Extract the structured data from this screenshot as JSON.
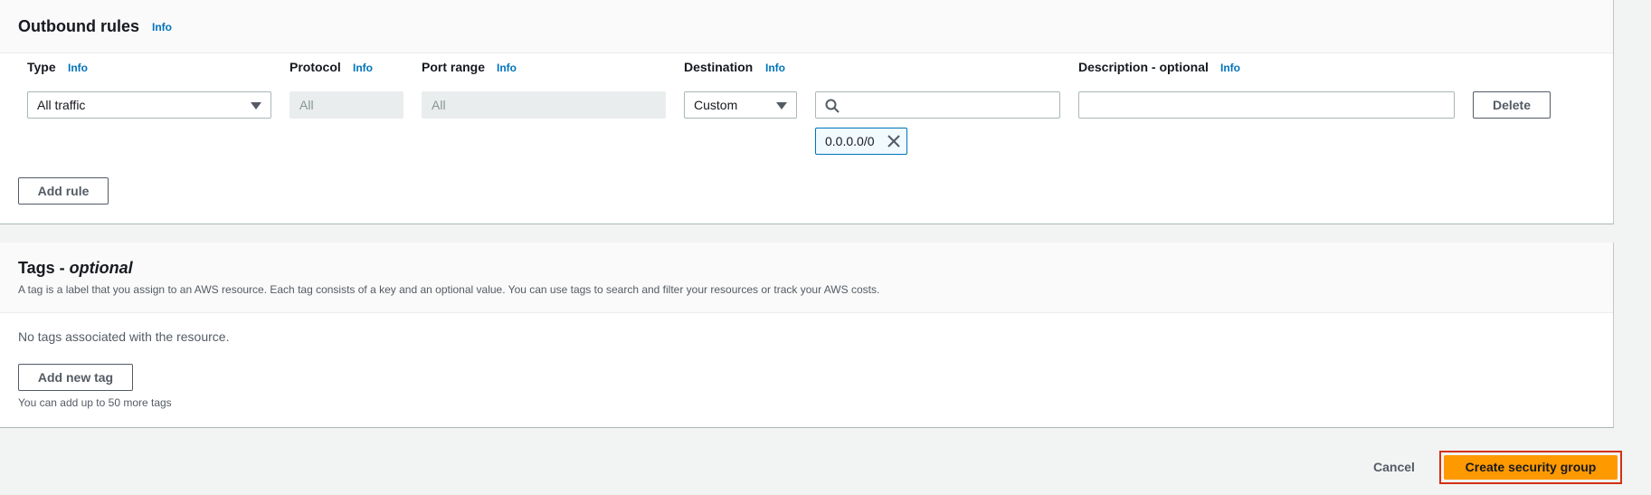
{
  "outbound": {
    "title": "Outbound rules",
    "info": "Info",
    "columns": {
      "type": "Type",
      "protocol": "Protocol",
      "port_range": "Port range",
      "destination": "Destination",
      "description": "Description - optional"
    },
    "rule": {
      "type_value": "All traffic",
      "protocol_value": "All",
      "port_range_value": "All",
      "destination_value": "Custom",
      "search_value": "",
      "description_value": "",
      "cidr_token": "0.0.0.0/0",
      "delete_label": "Delete"
    },
    "add_rule_label": "Add rule"
  },
  "tags": {
    "title_main": "Tags - ",
    "title_optional": "optional",
    "description": "A tag is a label that you assign to an AWS resource. Each tag consists of a key and an optional value. You can use tags to search and filter your resources or track your AWS costs.",
    "empty_text": "No tags associated with the resource.",
    "add_tag_label": "Add new tag",
    "limit_text": "You can add up to 50 more tags"
  },
  "footer": {
    "cancel_label": "Cancel",
    "create_label": "Create security group"
  },
  "colors": {
    "primary_button": "#ff9900",
    "highlight_border": "#d13212",
    "link": "#0073bb"
  },
  "icons": {
    "search": "search-icon",
    "close": "close-icon",
    "dropdown": "caret-down-icon"
  }
}
